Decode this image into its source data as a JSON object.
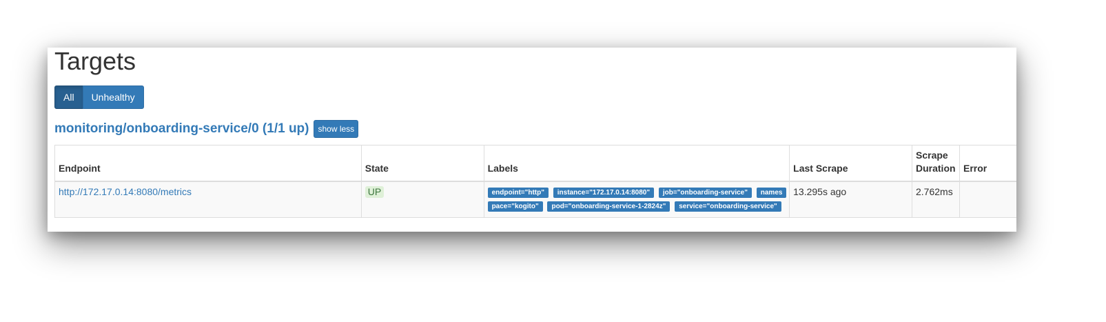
{
  "page": {
    "title": "Targets"
  },
  "filters": {
    "all_label": "All",
    "unhealthy_label": "Unhealthy"
  },
  "job": {
    "title": "monitoring/onboarding-service/0 (1/1 up)",
    "toggle_label": "show less"
  },
  "table": {
    "headers": {
      "endpoint": "Endpoint",
      "state": "State",
      "labels": "Labels",
      "last_scrape": "Last Scrape",
      "scrape_duration": "Scrape Duration",
      "error": "Error"
    },
    "rows": [
      {
        "endpoint": "http://172.17.0.14:8080/metrics",
        "state": "UP",
        "labels": [
          "endpoint=\"http\"",
          "instance=\"172.17.0.14:8080\"",
          "job=\"onboarding-service\"",
          "namespace=\"kogito\"",
          "pod=\"onboarding-service-1-2824z\"",
          "service=\"onboarding-service\""
        ],
        "last_scrape": "13.295s ago",
        "scrape_duration": "2.762ms",
        "error": ""
      }
    ]
  },
  "colors": {
    "primary": "#337ab7",
    "primary_active": "#286090",
    "up_bg": "#dff0d8",
    "up_text": "#3c763d"
  }
}
